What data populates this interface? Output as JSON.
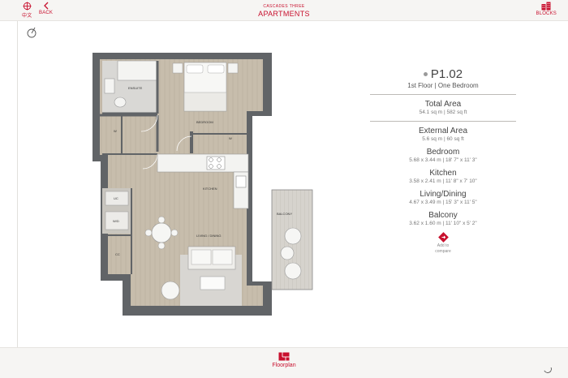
{
  "header": {
    "language_label": "中文",
    "back_label": "BACK",
    "subtitle": "CASCADES THREE",
    "title": "APARTMENTS",
    "blocks_label": "BLOCKS",
    "accent_color": "#c8102e"
  },
  "plan": {
    "rooms": {
      "ensuite": "ENSUITE",
      "bedroom": "BEDROOM",
      "wardrobe_left": "W",
      "wardrobe_right": "W",
      "kitchen": "KITCHEN",
      "balcony": "BALCONY",
      "living": "LIVING / DINING",
      "uc": "UC",
      "wd": "W/D",
      "cc": "CC"
    }
  },
  "unit": {
    "code": "P1.02",
    "type": "1st Floor | One Bedroom",
    "specs": [
      {
        "title": "Total Area",
        "value": "54.1 sq m | 582 sq ft"
      },
      {
        "title": "External Area",
        "value": "5.6 sq m | 60 sq ft"
      },
      {
        "title": "Bedroom",
        "value": "5.68 x 3.44 m | 18' 7\" x 11' 3\""
      },
      {
        "title": "Kitchen",
        "value": "3.58 x 2.41 m | 11' 8\" x 7' 10\""
      },
      {
        "title": "Living/Dining",
        "value": "4.67 x 3.49 m | 15' 3\" x 11' 5\""
      },
      {
        "title": "Balcony",
        "value": "3.62 x 1.60 m | 11' 10\" x 5' 2\""
      }
    ],
    "compare_line1": "Add to",
    "compare_line2": "compare"
  },
  "footer": {
    "floorplan_label": "Floorplan"
  }
}
